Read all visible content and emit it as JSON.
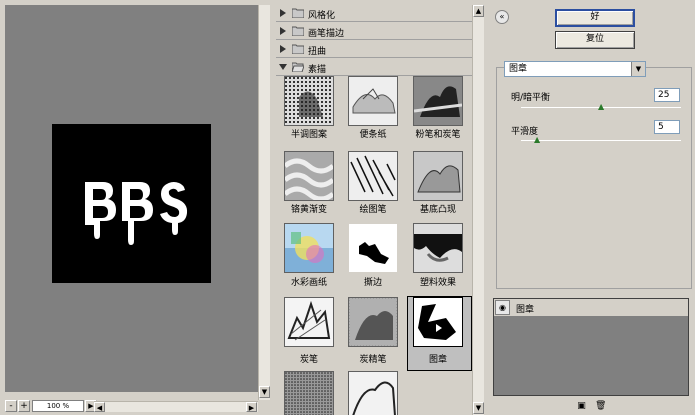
{
  "preview": {
    "zoom_value": "100 %",
    "zoom_out_label": "-",
    "zoom_in_label": "+",
    "image_text": "BBS"
  },
  "gallery": {
    "categories": [
      {
        "label": "风格化",
        "expanded": false
      },
      {
        "label": "画笔描边",
        "expanded": false
      },
      {
        "label": "扭曲",
        "expanded": false
      },
      {
        "label": "素描",
        "expanded": true
      }
    ],
    "filters": [
      {
        "label": "半调图案"
      },
      {
        "label": "便条纸"
      },
      {
        "label": "粉笔和炭笔"
      },
      {
        "label": "铬黄渐变"
      },
      {
        "label": "绘图笔"
      },
      {
        "label": "基底凸现"
      },
      {
        "label": "水彩画纸"
      },
      {
        "label": "撕边"
      },
      {
        "label": "塑料效果"
      },
      {
        "label": "炭笔"
      },
      {
        "label": "炭精笔"
      },
      {
        "label": "图章"
      },
      {
        "label": ""
      },
      {
        "label": ""
      }
    ],
    "selected": "图章"
  },
  "settings": {
    "collapse_icon": "«",
    "ok_label": "好",
    "reset_label": "复位",
    "filter_select_value": "图章",
    "params": [
      {
        "label": "明/暗平衡",
        "value": "25",
        "max": 50
      },
      {
        "label": "平滑度",
        "value": "5",
        "max": 50
      }
    ]
  },
  "layers": {
    "items": [
      {
        "label": "图章",
        "visible": true
      }
    ]
  },
  "colors": {
    "panel_bg": "#d4d0c8",
    "preview_bg": "#808080",
    "ok_border": "#2b4ea0"
  }
}
